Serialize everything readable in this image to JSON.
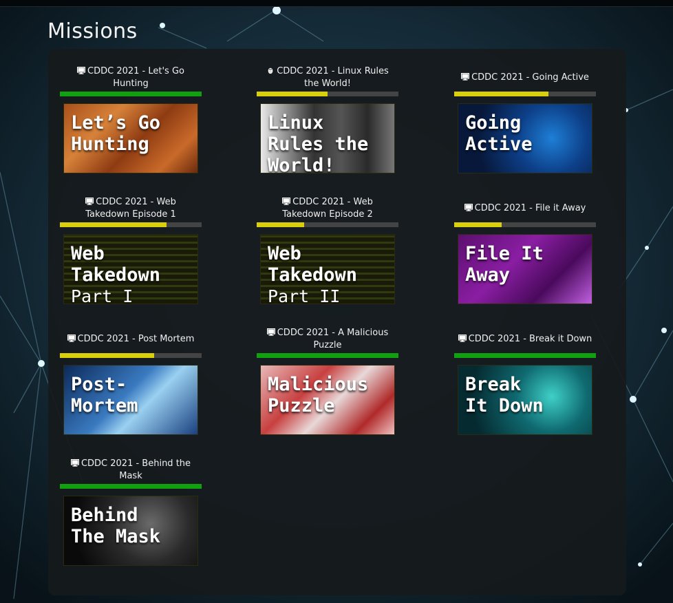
{
  "page": {
    "title": "Missions"
  },
  "colors": {
    "green": "#11a010",
    "yellow": "#d9cf0a",
    "track": "#444444"
  },
  "missions": [
    {
      "icon": "monitor-icon",
      "title": "CDDC 2021 - Let's Go Hunting",
      "progress": 1.0,
      "bar": "#11a010",
      "image_text": "Let’s Go\nHunting",
      "image_sub": "",
      "art": "hunting"
    },
    {
      "icon": "linux-penguin-icon",
      "title": "CDDC 2021 - Linux Rules the World!",
      "progress": 0.5,
      "bar": "#d9cf0a",
      "image_text": "Linux\nRules the\nWorld!",
      "image_sub": "",
      "art": "linux"
    },
    {
      "icon": "monitor-icon",
      "title": "CDDC 2021 - Going Active",
      "progress": 0.667,
      "bar": "#d9cf0a",
      "image_text": "Going\nActive",
      "image_sub": "",
      "art": "active"
    },
    {
      "icon": "monitor-icon",
      "title": "CDDC 2021 - Web Takedown Episode 1",
      "progress": 0.75,
      "bar": "#d9cf0a",
      "image_text": "Web\nTakedown",
      "image_sub": "Part I",
      "art": "web"
    },
    {
      "icon": "monitor-icon",
      "title": "CDDC 2021 - Web Takedown Episode 2",
      "progress": 0.333,
      "bar": "#d9cf0a",
      "image_text": "Web\nTakedown",
      "image_sub": "Part II",
      "art": "web"
    },
    {
      "icon": "monitor-icon",
      "title": "CDDC 2021 - File it Away",
      "progress": 0.333,
      "bar": "#d9cf0a",
      "image_text": "File It\nAway",
      "image_sub": "",
      "art": "file"
    },
    {
      "icon": "monitor-icon",
      "title": "CDDC 2021 - Post Mortem",
      "progress": 0.667,
      "bar": "#d9cf0a",
      "image_text": "Post-\nMortem",
      "image_sub": "",
      "art": "post"
    },
    {
      "icon": "monitor-icon",
      "title": "CDDC 2021 - A Malicious Puzzle",
      "progress": 1.0,
      "bar": "#11a010",
      "image_text": "Malicious\nPuzzle",
      "image_sub": "",
      "art": "puzzle"
    },
    {
      "icon": "monitor-icon",
      "title": "CDDC 2021 - Break it Down",
      "progress": 1.0,
      "bar": "#11a010",
      "image_text": "Break\nIt Down",
      "image_sub": "",
      "art": "break"
    },
    {
      "icon": "monitor-icon",
      "title": "CDDC 2021 - Behind the Mask",
      "progress": 1.0,
      "bar": "#11a010",
      "image_text": "Behind\nThe Mask",
      "image_sub": "",
      "art": "mask"
    }
  ]
}
